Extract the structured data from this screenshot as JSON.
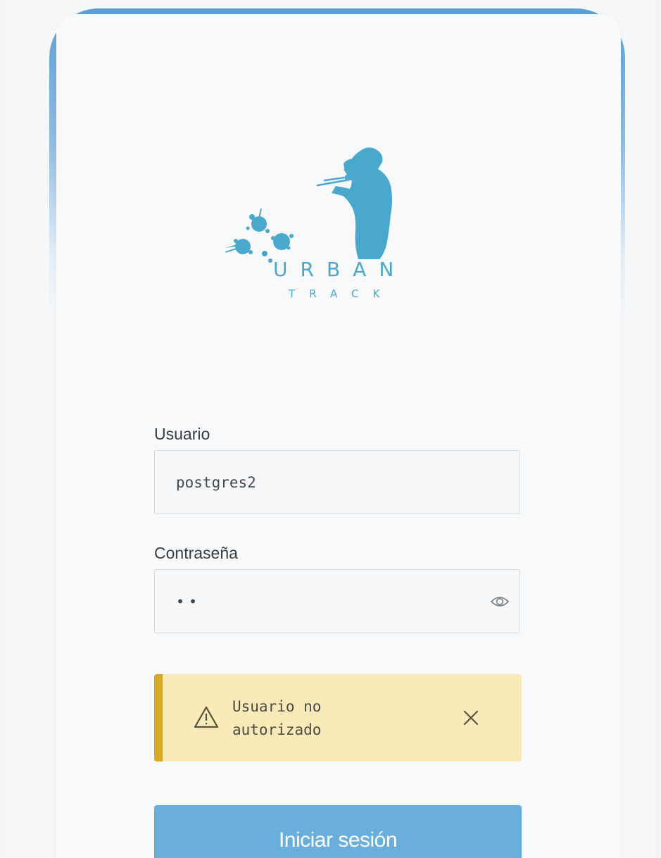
{
  "brand": {
    "logo_text_main": "URBAN",
    "logo_text_sub": "TRACK",
    "color": "#4aa8cc"
  },
  "form": {
    "username": {
      "label": "Usuario",
      "value": "postgres2"
    },
    "password": {
      "label": "Contraseña",
      "masked_value": "••",
      "toggle_icon": "eye-icon"
    },
    "alert": {
      "message": "Usuario no autorizado",
      "icon": "warning-triangle-icon",
      "close_icon": "close-icon"
    },
    "submit_label": "Iniciar sesión"
  },
  "colors": {
    "accent": "#6aaedb",
    "alert_bg": "#faeab9",
    "alert_bar": "#d9a825",
    "frame_blue": "#5b9fd6"
  }
}
